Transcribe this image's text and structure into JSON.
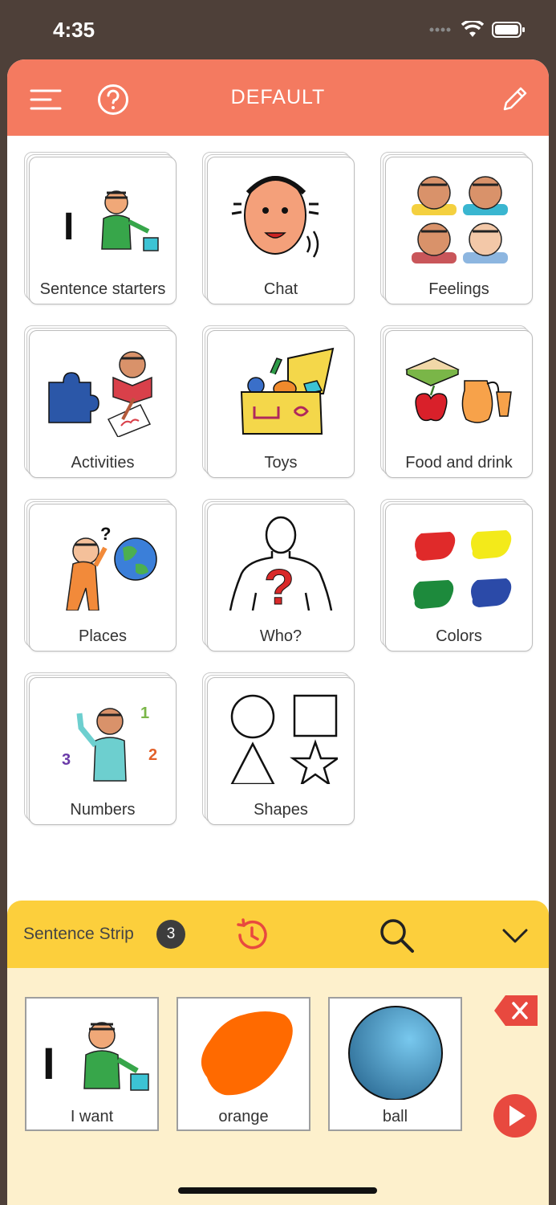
{
  "status": {
    "time": "4:35"
  },
  "header": {
    "title": "DEFAULT"
  },
  "grid": {
    "tiles": [
      {
        "label": "Sentence starters"
      },
      {
        "label": "Chat"
      },
      {
        "label": "Feelings"
      },
      {
        "label": "Activities"
      },
      {
        "label": "Toys"
      },
      {
        "label": "Food and drink"
      },
      {
        "label": "Places"
      },
      {
        "label": "Who?"
      },
      {
        "label": "Colors"
      },
      {
        "label": "Numbers"
      },
      {
        "label": "Shapes"
      }
    ]
  },
  "strip": {
    "title": "Sentence Strip",
    "count": "3",
    "cards": [
      {
        "label": "I want"
      },
      {
        "label": "orange"
      },
      {
        "label": "ball"
      }
    ]
  },
  "colors": {
    "header": "#f47a60",
    "strip_header": "#fccf3c",
    "strip_bg": "#fdf0cc",
    "accent_red": "#e8493f"
  }
}
